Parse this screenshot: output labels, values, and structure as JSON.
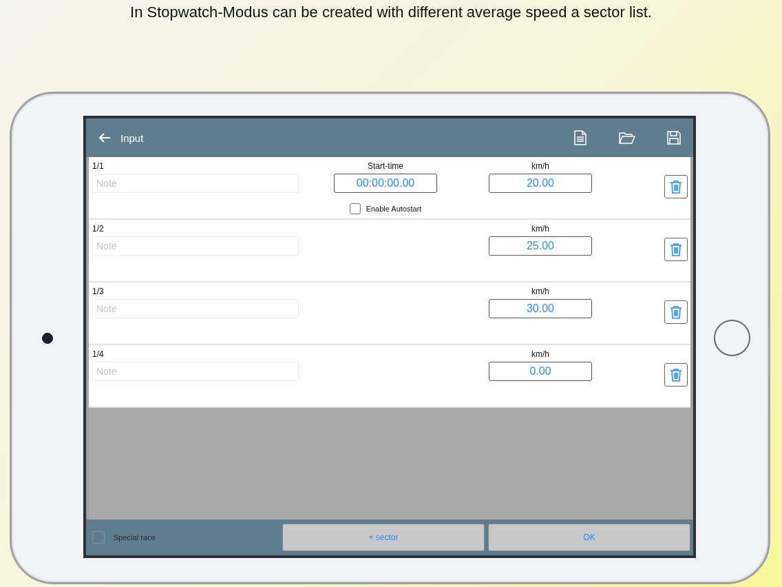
{
  "caption": "In Stopwatch-Modus can be created with different average speed a sector list.",
  "header": {
    "title": "Input"
  },
  "sectors": [
    {
      "label": "1/1",
      "note_placeholder": "Note",
      "start_label": "Start-time",
      "start_time": "00:00:00.00",
      "speed_label": "km/h",
      "speed": "20.00",
      "autostart": {
        "label": "Enable Autostart",
        "checked": false
      }
    },
    {
      "label": "1/2",
      "note_placeholder": "Note",
      "speed_label": "km/h",
      "speed": "25.00"
    },
    {
      "label": "1/3",
      "note_placeholder": "Note",
      "speed_label": "km/h",
      "speed": "30.00"
    },
    {
      "label": "1/4",
      "note_placeholder": "Note",
      "speed_label": "km/h",
      "speed": "0.00"
    }
  ],
  "footer": {
    "special_race": {
      "label": "Special race",
      "checked": false
    },
    "buttons": [
      "+ sector",
      "OK"
    ]
  }
}
